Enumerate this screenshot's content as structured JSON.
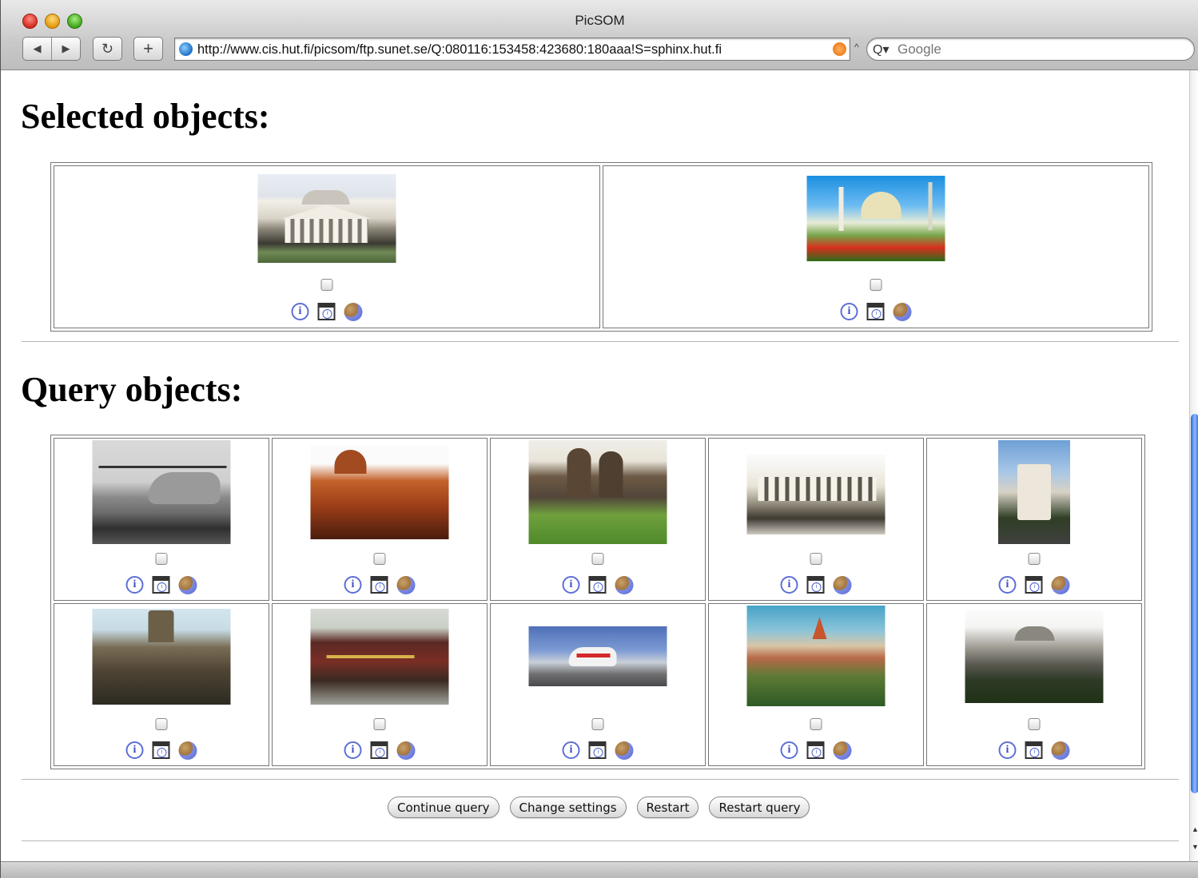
{
  "window": {
    "title": "PicSOM"
  },
  "toolbar": {
    "back_glyph": "◀",
    "forward_glyph": "▶",
    "reload_glyph": "↻",
    "add_glyph": "+",
    "url": "http://www.cis.hut.fi/picsom/ftp.sunet.se/Q:080116:153458:423680:180aaa!S=sphinx.hut.fi",
    "search_placeholder": "Google"
  },
  "sections": {
    "selected_title": "Selected objects:",
    "query_title": "Query objects:"
  },
  "icons": {
    "info_glyph": "i",
    "page_glyph": "i"
  },
  "selected_objects": [
    {
      "name": "villa-rotonda",
      "checked": false
    },
    {
      "name": "domed-church-with-flowers",
      "checked": false
    }
  ],
  "query_objects": [
    {
      "name": "helicopter-camouflage",
      "checked": false
    },
    {
      "name": "red-brick-domed-building",
      "checked": false
    },
    {
      "name": "khmer-temple-towers",
      "checked": false
    },
    {
      "name": "palladian-palace",
      "checked": false
    },
    {
      "name": "round-tower",
      "checked": false
    },
    {
      "name": "baroque-facade",
      "checked": false
    },
    {
      "name": "old-train",
      "checked": false
    },
    {
      "name": "rescue-helicopter",
      "checked": false
    },
    {
      "name": "bran-castle",
      "checked": false
    },
    {
      "name": "villa-rotonda-2",
      "checked": false
    }
  ],
  "buttons": {
    "continue": "Continue query",
    "settings": "Change settings",
    "restart": "Restart",
    "restart_query": "Restart query"
  }
}
